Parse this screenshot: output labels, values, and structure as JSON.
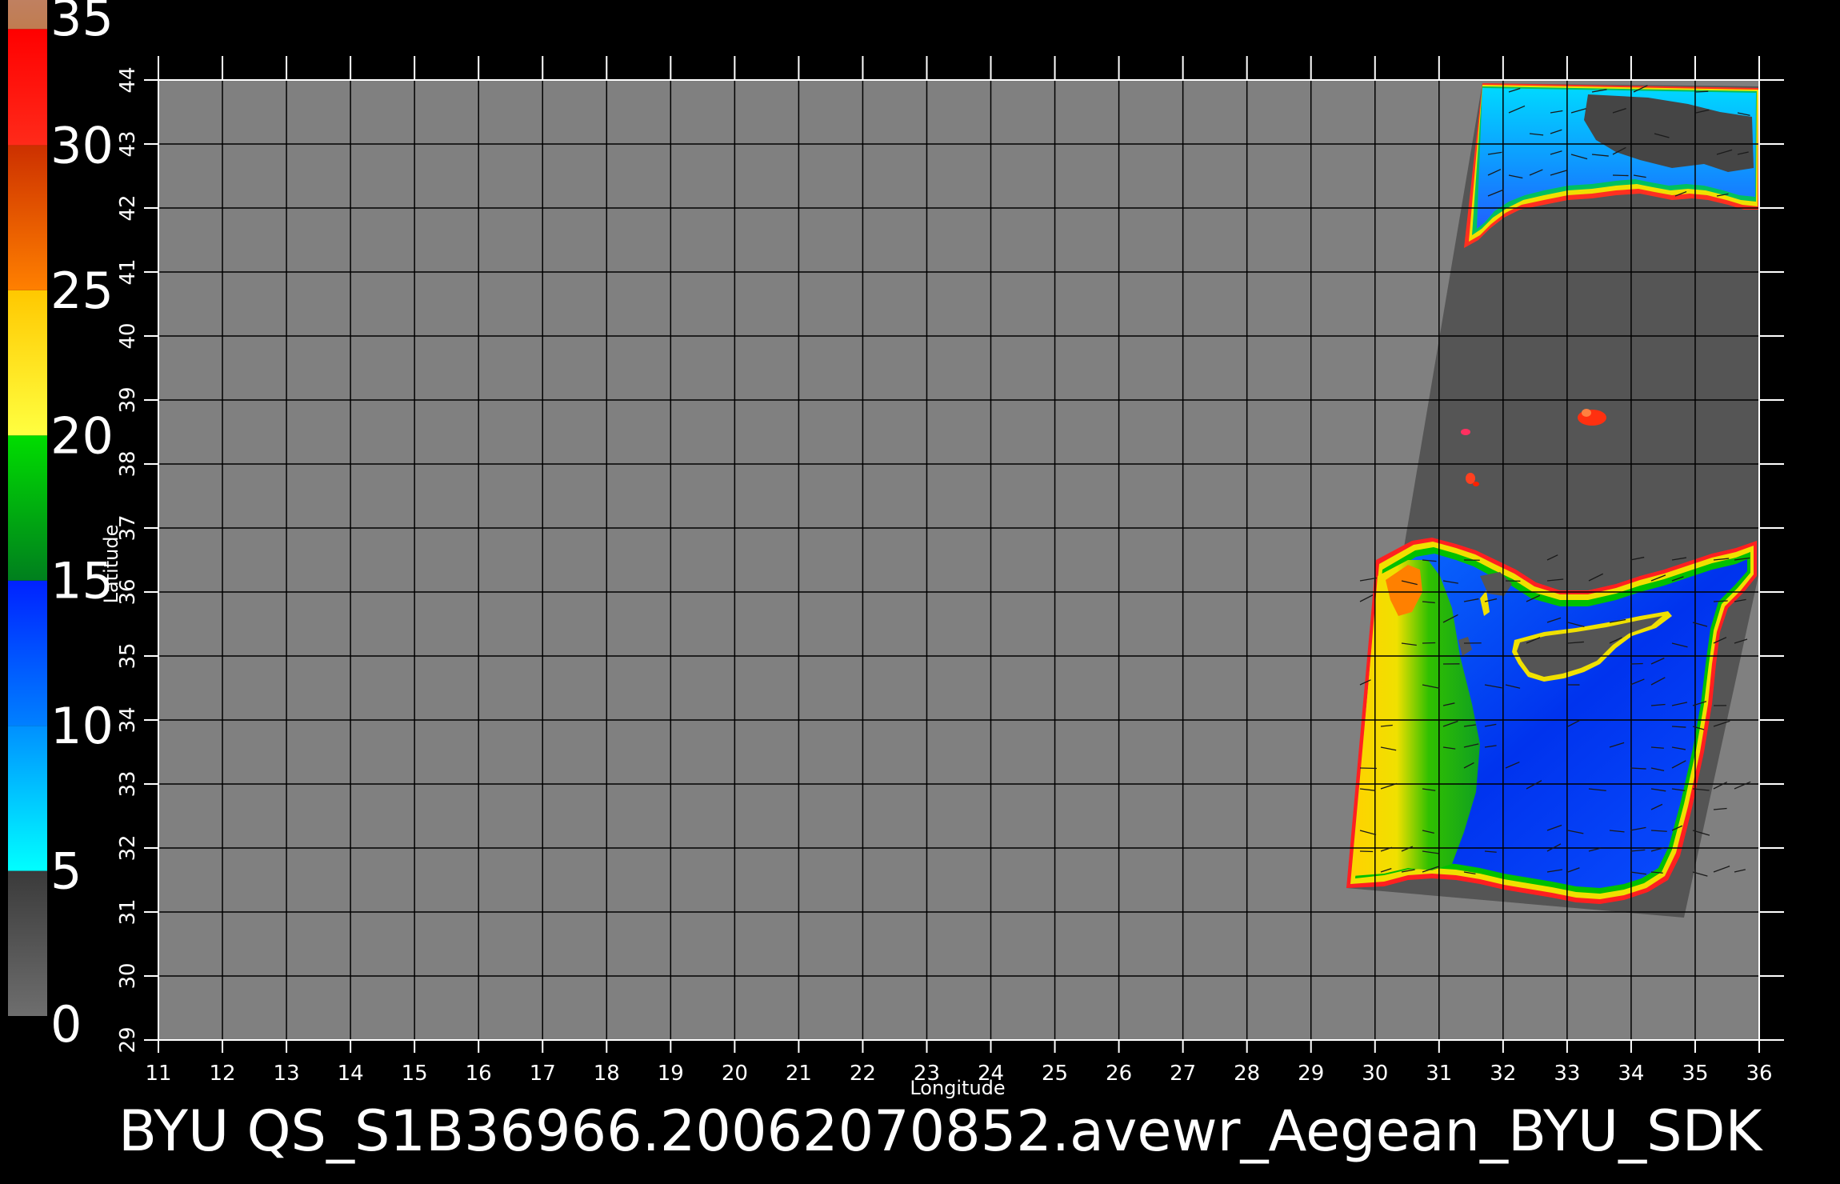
{
  "colorbar": {
    "labels": [
      "35",
      "30",
      "25",
      "20",
      "15",
      "10",
      "5",
      "0"
    ],
    "stops": [
      {
        "from": 0,
        "to": 5,
        "colors": [
          "#6e6e6e",
          "#3a3a3a"
        ]
      },
      {
        "from": 5,
        "to": 10,
        "colors": [
          "#00ffff",
          "#0090ff"
        ]
      },
      {
        "from": 10,
        "to": 15,
        "colors": [
          "#0080ff",
          "#0022ff"
        ]
      },
      {
        "from": 15,
        "to": 20,
        "colors": [
          "#007f1e",
          "#00dd00"
        ]
      },
      {
        "from": 20,
        "to": 25,
        "colors": [
          "#ffff40",
          "#ffc800"
        ]
      },
      {
        "from": 25,
        "to": 30,
        "colors": [
          "#ff8000",
          "#cc3000"
        ]
      },
      {
        "from": 30,
        "to": 34,
        "colors": [
          "#ff2a1a",
          "#ff0000"
        ]
      },
      {
        "from": 34,
        "to": 35,
        "colors": [
          "#c07c50",
          "#c08060"
        ]
      }
    ]
  },
  "map": {
    "lon_min": 11,
    "lon_max": 36,
    "lat_min": 29,
    "lat_max": 44,
    "lon_ticks": [
      "11",
      "12",
      "13",
      "14",
      "15",
      "16",
      "17",
      "18",
      "19",
      "20",
      "21",
      "22",
      "23",
      "24",
      "25",
      "26",
      "27",
      "28",
      "29",
      "30",
      "31",
      "32",
      "33",
      "34",
      "35",
      "36"
    ],
    "lat_ticks": [
      "29",
      "30",
      "31",
      "32",
      "33",
      "34",
      "35",
      "36",
      "37",
      "38",
      "39",
      "40",
      "41",
      "42",
      "43",
      "44"
    ],
    "xlabel": "Longitude",
    "ylabel": "Latitude",
    "background_color": "#808080",
    "swath_color": "#555555",
    "land_color": "#555555"
  },
  "caption": "BYU  QS_S1B36966.20062070852.avewr_Aegean_BYU_SDK"
}
